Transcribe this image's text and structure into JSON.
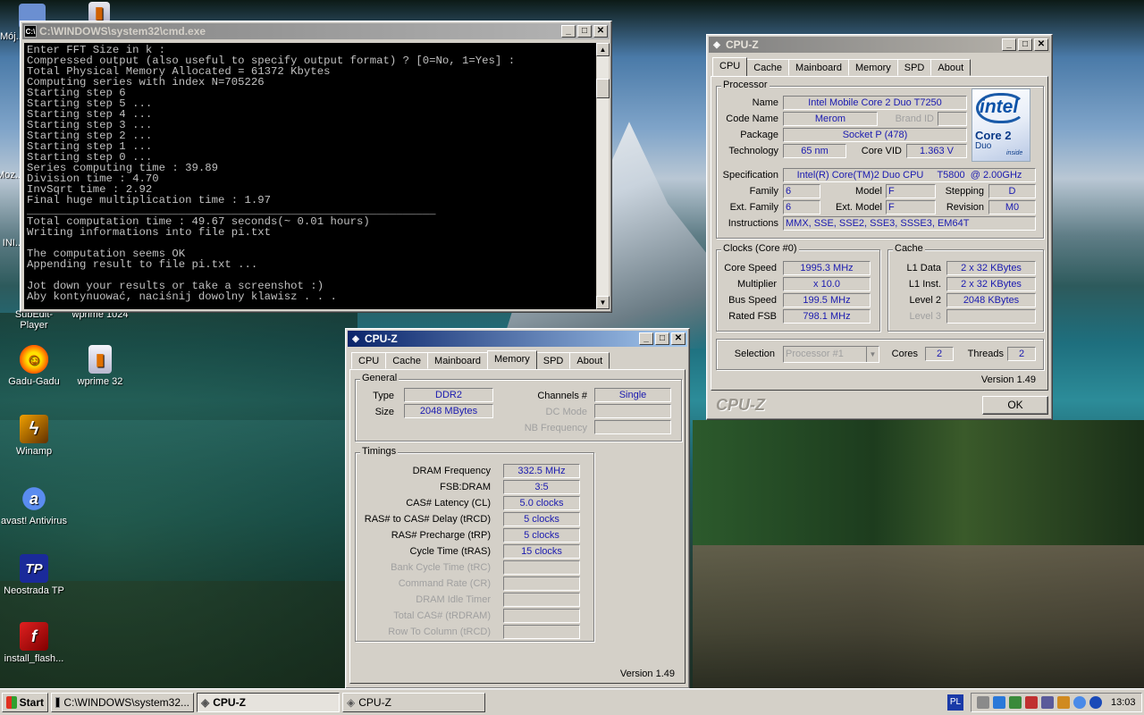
{
  "desktop": {
    "icons": [
      {
        "label": "Mój..."
      },
      {
        "label": "Moz..."
      },
      {
        "label": "INI..."
      },
      {
        "label": "SubEdit-Player"
      },
      {
        "label": "wprime 1024"
      },
      {
        "label": "Gadu-Gadu"
      },
      {
        "label": "wprime 32"
      },
      {
        "label": "Winamp"
      },
      {
        "label": "avast! Antivirus"
      },
      {
        "label": "Neostrada TP"
      },
      {
        "label": "install_flash..."
      }
    ]
  },
  "cmd": {
    "title": "C:\\WINDOWS\\system32\\cmd.exe",
    "lines": [
      "Enter FFT Size in k :",
      "Compressed output (also useful to specify output format) ? [0=No, 1=Yes] :",
      "Total Physical Memory Allocated = 61372 Kbytes",
      "Computing series with index N=705226",
      "Starting step 6",
      "Starting step 5 ...",
      "Starting step 4 ...",
      "Starting step 3 ...",
      "Starting step 2 ...",
      "Starting step 1 ...",
      "Starting step 0 ...",
      "Series computing time : 39.89",
      "Division time : 4.70",
      "InvSqrt time : 2.92",
      "Final huge multiplication time : 1.97",
      "______________________________________________________________",
      "Total computation time : 49.67 seconds(~ 0.01 hours)",
      "Writing informations into file pi.txt",
      "",
      "The computation seems OK",
      "Appending result to file pi.txt ...",
      "",
      "Jot down your results or take a screenshot :)",
      "Aby kontynuować, naciśnij dowolny klawisz . . ."
    ]
  },
  "cpuz_main": {
    "title": "CPU-Z",
    "tabs": [
      "CPU",
      "Cache",
      "Mainboard",
      "Memory",
      "SPD",
      "About"
    ],
    "selected_tab": "CPU",
    "processor_group": "Processor",
    "name_label": "Name",
    "name": "Intel Mobile Core 2 Duo T7250",
    "codename_label": "Code Name",
    "codename": "Merom",
    "brandid_label": "Brand ID",
    "brandid": "",
    "package_label": "Package",
    "package": "Socket P (478)",
    "technology_label": "Technology",
    "technology": "65 nm",
    "corevid_label": "Core VID",
    "corevid": "1.363 V",
    "spec_label": "Specification",
    "spec": "Intel(R) Core(TM)2 Duo CPU     T5800  @ 2.00GHz",
    "family_label": "Family",
    "family": "6",
    "model_label": "Model",
    "model": "F",
    "stepping_label": "Stepping",
    "stepping": "D",
    "extfamily_label": "Ext. Family",
    "extfamily": "6",
    "extmodel_label": "Ext. Model",
    "extmodel": "F",
    "revision_label": "Revision",
    "revision": "M0",
    "instructions_label": "Instructions",
    "instructions": "MMX, SSE, SSE2, SSE3, SSSE3, EM64T",
    "logo": {
      "brand": "intel",
      "line1": "Core 2",
      "line2": "Duo",
      "inside": "inside"
    },
    "clocks_group": "Clocks (Core #0)",
    "corespeed_label": "Core Speed",
    "corespeed": "1995.3 MHz",
    "multiplier_label": "Multiplier",
    "multiplier": "x 10.0",
    "busspeed_label": "Bus Speed",
    "busspeed": "199.5 MHz",
    "ratedfsb_label": "Rated FSB",
    "ratedfsb": "798.1 MHz",
    "cache_group": "Cache",
    "l1data_label": "L1 Data",
    "l1data": "2 x 32 KBytes",
    "l1inst_label": "L1 Inst.",
    "l1inst": "2 x 32 KBytes",
    "level2_label": "Level 2",
    "level2": "2048 KBytes",
    "level3_label": "Level 3",
    "level3": "",
    "selection_label": "Selection",
    "selection": "Processor #1",
    "cores_label": "Cores",
    "cores": "2",
    "threads_label": "Threads",
    "threads": "2",
    "version": "Version 1.49",
    "brand_footer": "CPU-Z",
    "ok_label": "OK"
  },
  "cpuz_mem": {
    "title": "CPU-Z",
    "tabs": [
      "CPU",
      "Cache",
      "Mainboard",
      "Memory",
      "SPD",
      "About"
    ],
    "selected_tab": "Memory",
    "general_group": "General",
    "type_label": "Type",
    "type": "DDR2",
    "size_label": "Size",
    "size": "2048 MBytes",
    "channels_label": "Channels #",
    "channels": "Single",
    "dcmode_label": "DC Mode",
    "dcmode": "",
    "nbfreq_label": "NB Frequency",
    "nbfreq": "",
    "timings_group": "Timings",
    "timings": [
      {
        "label": "DRAM Frequency",
        "value": "332.5 MHz",
        "dim": false
      },
      {
        "label": "FSB:DRAM",
        "value": "3:5",
        "dim": false
      },
      {
        "label": "CAS# Latency (CL)",
        "value": "5.0 clocks",
        "dim": false
      },
      {
        "label": "RAS# to CAS# Delay (tRCD)",
        "value": "5 clocks",
        "dim": false
      },
      {
        "label": "RAS# Precharge (tRP)",
        "value": "5 clocks",
        "dim": false
      },
      {
        "label": "Cycle Time (tRAS)",
        "value": "15 clocks",
        "dim": false
      },
      {
        "label": "Bank Cycle Time (tRC)",
        "value": "",
        "dim": true
      },
      {
        "label": "Command Rate (CR)",
        "value": "",
        "dim": true
      },
      {
        "label": "DRAM Idle Timer",
        "value": "",
        "dim": true
      },
      {
        "label": "Total CAS# (tRDRAM)",
        "value": "",
        "dim": true
      },
      {
        "label": "Row To Column (tRCD)",
        "value": "",
        "dim": true
      }
    ],
    "version": "Version 1.49"
  },
  "taskbar": {
    "start_label": "Start",
    "items": [
      {
        "label": "C:\\WINDOWS\\system32..."
      },
      {
        "label": "CPU-Z"
      },
      {
        "label": "CPU-Z"
      }
    ],
    "lang": "PL",
    "clock": "13:03"
  },
  "colors": {
    "title_active": "#0a246a",
    "title_inactive": "#808080",
    "value_text": "#1a1ab0",
    "face": "#d4d0c8"
  }
}
